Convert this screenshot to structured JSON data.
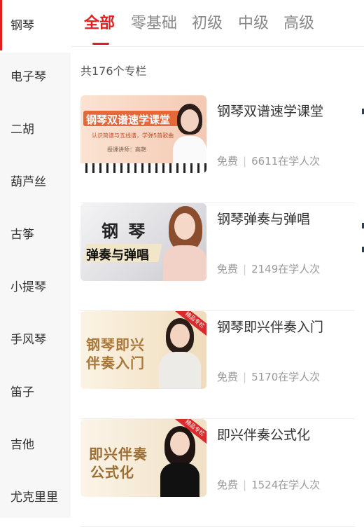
{
  "sidebar": {
    "items": [
      {
        "label": "钢琴",
        "active": true
      },
      {
        "label": "电子琴",
        "active": false
      },
      {
        "label": "二胡",
        "active": false
      },
      {
        "label": "葫芦丝",
        "active": false
      },
      {
        "label": "古筝",
        "active": false
      },
      {
        "label": "小提琴",
        "active": false
      },
      {
        "label": "手风琴",
        "active": false
      },
      {
        "label": "笛子",
        "active": false
      },
      {
        "label": "吉他",
        "active": false
      },
      {
        "label": "尤克里里",
        "active": false
      }
    ]
  },
  "tabs": [
    {
      "label": "全部",
      "active": true
    },
    {
      "label": "零基础",
      "active": false
    },
    {
      "label": "初级",
      "active": false
    },
    {
      "label": "中级",
      "active": false
    },
    {
      "label": "高级",
      "active": false
    }
  ],
  "count_text": "共176个专栏",
  "courses": [
    {
      "title": "钢琴双谱速学课堂",
      "price": "免费",
      "learners": "6611在学人次",
      "thumb": {
        "title": "钢琴双谱速学课堂",
        "subtitle": "认识简谱与五线谱，学弹5首歌曲",
        "teacher": "授课讲师：高艳",
        "bg": "#f6d3bd",
        "accent": "#e5683a"
      }
    },
    {
      "title": "钢琴弹奏与弹唱",
      "price": "免费",
      "learners": "2149在学人次",
      "thumb": {
        "title_line1": "钢 琴",
        "title_line2": "弹奏与弹唱",
        "bg": "#e9e9eb"
      }
    },
    {
      "title": "钢琴即兴伴奏入门",
      "price": "免费",
      "learners": "5170在学人次",
      "thumb": {
        "title_line1": "钢琴即兴",
        "title_line2": "伴奏入门",
        "ribbon": "精品专栏",
        "bg": "#f5e9d3",
        "accent": "#a9773a"
      }
    },
    {
      "title": "即兴伴奏公式化",
      "price": "免费",
      "learners": "1524在学人次",
      "thumb": {
        "title_line1": "即兴伴奏",
        "title_line2": "公式化",
        "ribbon": "精品专栏",
        "bg": "#f4ead8",
        "accent": "#9b6e35"
      }
    }
  ],
  "colors": {
    "accent": "#e02020",
    "muted": "#999999",
    "sidebar_bg": "#f7f7f7"
  }
}
